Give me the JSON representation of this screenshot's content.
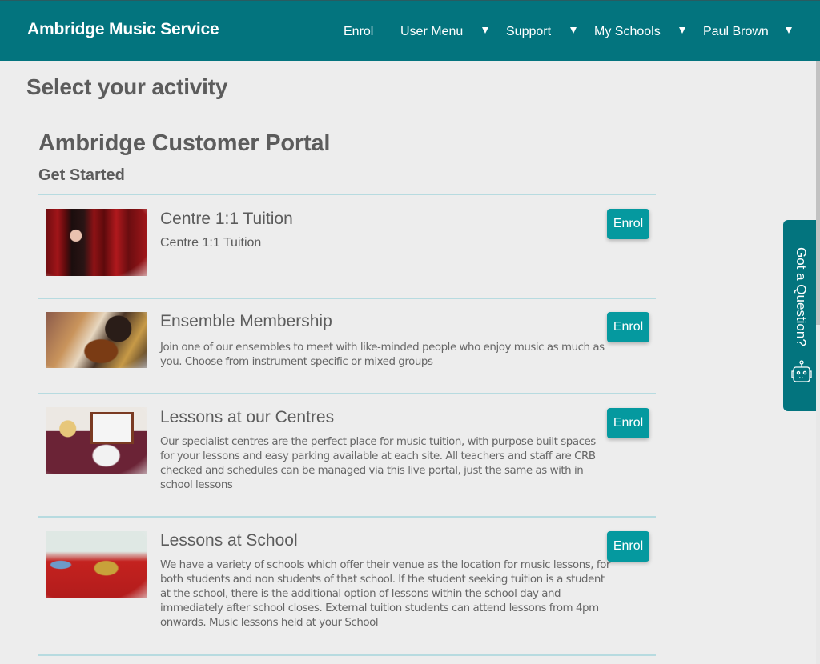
{
  "navbar": {
    "brand": "Ambridge Music Service",
    "items": [
      {
        "label": "Enrol",
        "has_dropdown": false
      },
      {
        "label": "User Menu",
        "has_dropdown": true
      },
      {
        "label": "Support",
        "has_dropdown": true
      },
      {
        "label": "My Schools",
        "has_dropdown": true
      },
      {
        "label": "Paul Brown",
        "has_dropdown": true
      }
    ],
    "dropdown_icon": "caret-down-icon"
  },
  "page": {
    "title": "Select your activity",
    "portal_title": "Ambridge Customer Portal",
    "portal_subtitle": "Get Started"
  },
  "activities": [
    {
      "title": "Centre 1:1 Tuition",
      "subtitle": "Centre 1:1 Tuition",
      "description": "",
      "image": "child-peeking-through-red-stage-curtains",
      "button_label": "Enrol"
    },
    {
      "title": "Ensemble Membership",
      "description": "Join one of our ensembles to meet with like-minded people who enjoy music as much as you. Choose from instrument specific or mixed groups",
      "image": "young-violinists-in-orchestra",
      "button_label": "Enrol"
    },
    {
      "title": "Lessons at our Centres",
      "description": "Our specialist centres are the perfect place for music tuition, with purpose built spaces for your lessons and easy parking available at each site. All teachers and staff are CRB checked and schedules can be managed via this live portal, just the same as with in school lessons",
      "image": "teacher-with-singing-students",
      "button_label": "Enrol"
    },
    {
      "title": "Lessons at School",
      "description": "We have a variety of schools which offer their venue as the location for music lessons, for both students and non students of that school. If the student seeking tuition is a student at the school, there is the additional option of lessons within the school day and immediately after school closes. External tuition students can attend lessons from 4pm onwards. Music lessons held at your School",
      "image": "teacher-with-brass-band-students",
      "button_label": "Enrol"
    }
  ],
  "help_tab": {
    "label": "Got a Question?",
    "icon": "robot-icon"
  },
  "colors": {
    "brand": "#03747e",
    "button": "#05999f",
    "divider": "#b7dbe0",
    "background": "#ededed"
  }
}
